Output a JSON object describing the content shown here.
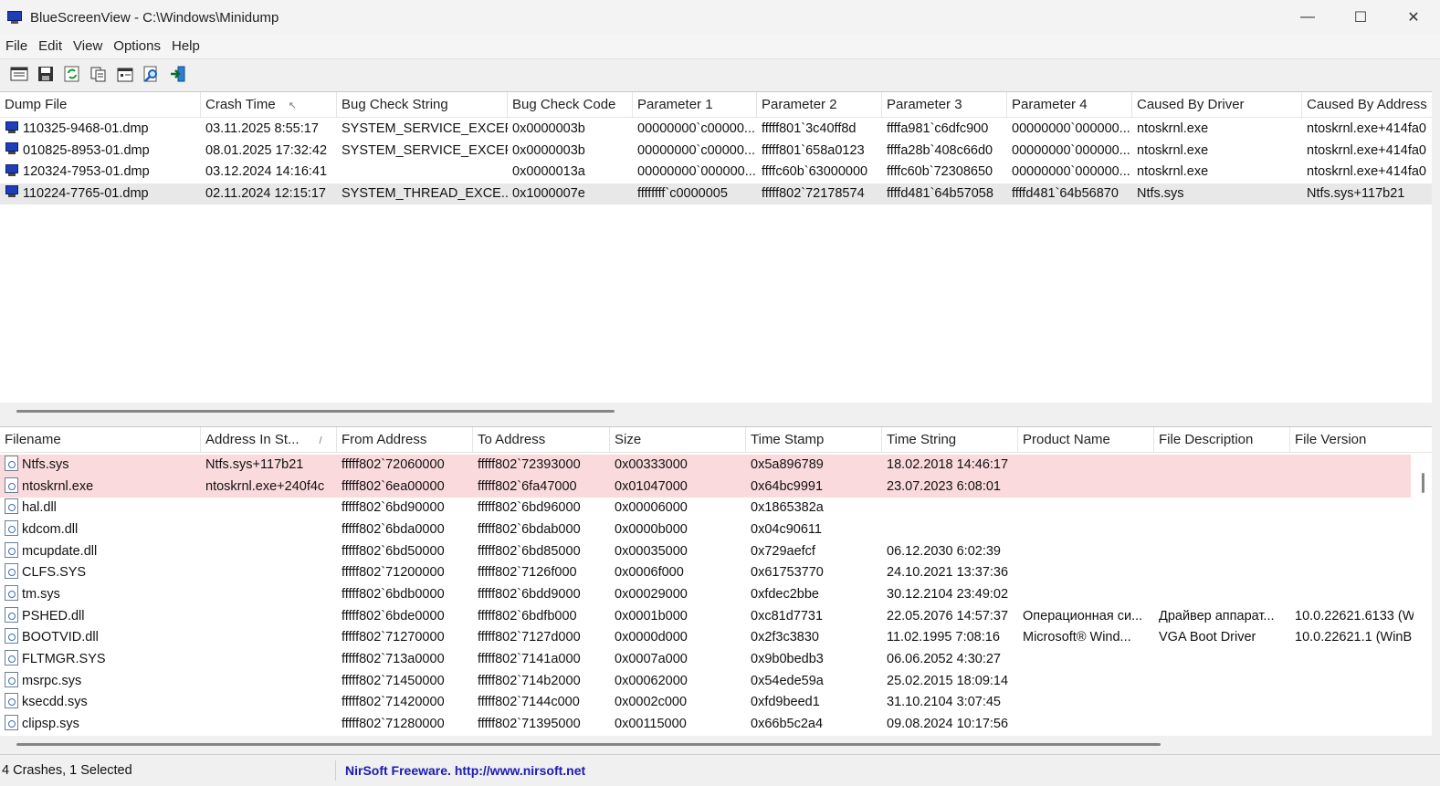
{
  "window": {
    "title": "BlueScreenView  -  C:\\Windows\\Minidump",
    "minimize": "—",
    "maximize": "☐",
    "close": "✕"
  },
  "menu": [
    "File",
    "Edit",
    "View",
    "Options",
    "Help"
  ],
  "toolbar": [
    "properties-window-icon",
    "save-icon",
    "refresh-icon",
    "copy-icon",
    "properties-icon",
    "find-icon",
    "exit-icon"
  ],
  "crashes": {
    "columns": [
      "Dump File",
      "Crash Time",
      "Bug Check String",
      "Bug Check Code",
      "Parameter 1",
      "Parameter 2",
      "Parameter 3",
      "Parameter 4",
      "Caused By Driver",
      "Caused By Address"
    ],
    "sort_indicator": "↖",
    "rows": [
      [
        "110325-9468-01.dmp",
        "03.11.2025 8:55:17",
        "SYSTEM_SERVICE_EXCEP...",
        "0x0000003b",
        "00000000`c00000...",
        "fffff801`3c40ff8d",
        "ffffa981`c6dfc900",
        "00000000`000000...",
        "ntoskrnl.exe",
        "ntoskrnl.exe+414fa0"
      ],
      [
        "010825-8953-01.dmp",
        "08.01.2025 17:32:42",
        "SYSTEM_SERVICE_EXCEP...",
        "0x0000003b",
        "00000000`c00000...",
        "fffff801`658a0123",
        "ffffa28b`408c66d0",
        "00000000`000000...",
        "ntoskrnl.exe",
        "ntoskrnl.exe+414fa0"
      ],
      [
        "120324-7953-01.dmp",
        "03.12.2024 14:16:41",
        "",
        "0x0000013a",
        "00000000`000000...",
        "ffffc60b`63000000",
        "ffffc60b`72308650",
        "00000000`000000...",
        "ntoskrnl.exe",
        "ntoskrnl.exe+414fa0"
      ],
      [
        "110224-7765-01.dmp",
        "02.11.2024 12:15:17",
        "SYSTEM_THREAD_EXCE...",
        "0x1000007e",
        "ffffffff`c0000005",
        "fffff802`72178574",
        "ffffd481`64b57058",
        "ffffd481`64b56870",
        "Ntfs.sys",
        "Ntfs.sys+117b21"
      ]
    ],
    "selected_index": 3
  },
  "drivers": {
    "columns": [
      "Filename",
      "Address In St...",
      "From Address",
      "To Address",
      "Size",
      "Time Stamp",
      "Time String",
      "Product Name",
      "File Description",
      "File Version"
    ],
    "sort_indicator": "/",
    "rows": [
      [
        "Ntfs.sys",
        "Ntfs.sys+117b21",
        "fffff802`72060000",
        "fffff802`72393000",
        "0x00333000",
        "0x5a896789",
        "18.02.2018 14:46:17",
        "",
        "",
        ""
      ],
      [
        "ntoskrnl.exe",
        "ntoskrnl.exe+240f4c",
        "fffff802`6ea00000",
        "fffff802`6fa47000",
        "0x01047000",
        "0x64bc9991",
        "23.07.2023 6:08:01",
        "",
        "",
        ""
      ],
      [
        "hal.dll",
        "",
        "fffff802`6bd90000",
        "fffff802`6bd96000",
        "0x00006000",
        "0x1865382a",
        "",
        "",
        "",
        ""
      ],
      [
        "kdcom.dll",
        "",
        "fffff802`6bda0000",
        "fffff802`6bdab000",
        "0x0000b000",
        "0x04c90611",
        "",
        "",
        "",
        ""
      ],
      [
        "mcupdate.dll",
        "",
        "fffff802`6bd50000",
        "fffff802`6bd85000",
        "0x00035000",
        "0x729aefcf",
        "06.12.2030 6:02:39",
        "",
        "",
        ""
      ],
      [
        "CLFS.SYS",
        "",
        "fffff802`71200000",
        "fffff802`7126f000",
        "0x0006f000",
        "0x61753770",
        "24.10.2021 13:37:36",
        "",
        "",
        ""
      ],
      [
        "tm.sys",
        "",
        "fffff802`6bdb0000",
        "fffff802`6bdd9000",
        "0x00029000",
        "0xfdec2bbe",
        "30.12.2104 23:49:02",
        "",
        "",
        ""
      ],
      [
        "PSHED.dll",
        "",
        "fffff802`6bde0000",
        "fffff802`6bdfb000",
        "0x0001b000",
        "0xc81d7731",
        "22.05.2076 14:57:37",
        "Операционная си...",
        "Драйвер аппарат...",
        "10.0.22621.6133 (W"
      ],
      [
        "BOOTVID.dll",
        "",
        "fffff802`71270000",
        "fffff802`7127d000",
        "0x0000d000",
        "0x2f3c3830",
        "11.02.1995 7:08:16",
        "Microsoft® Wind...",
        "VGA Boot Driver",
        "10.0.22621.1 (WinB"
      ],
      [
        "FLTMGR.SYS",
        "",
        "fffff802`713a0000",
        "fffff802`7141a000",
        "0x0007a000",
        "0x9b0bedb3",
        "06.06.2052 4:30:27",
        "",
        "",
        ""
      ],
      [
        "msrpc.sys",
        "",
        "fffff802`71450000",
        "fffff802`714b2000",
        "0x00062000",
        "0x54ede59a",
        "25.02.2015 18:09:14",
        "",
        "",
        ""
      ],
      [
        "ksecdd.sys",
        "",
        "fffff802`71420000",
        "fffff802`7144c000",
        "0x0002c000",
        "0xfd9beed1",
        "31.10.2104 3:07:45",
        "",
        "",
        ""
      ],
      [
        "clipsp.sys",
        "",
        "fffff802`71280000",
        "fffff802`71395000",
        "0x00115000",
        "0x66b5c2a4",
        "09.08.2024 10:17:56",
        "",
        "",
        ""
      ]
    ],
    "highlighted_rows": [
      0,
      1
    ],
    "highlight_color": "#fadadd"
  },
  "status": {
    "count": "4 Crashes, 1 Selected",
    "link": "NirSoft Freeware.  http://www.nirsoft.net"
  }
}
